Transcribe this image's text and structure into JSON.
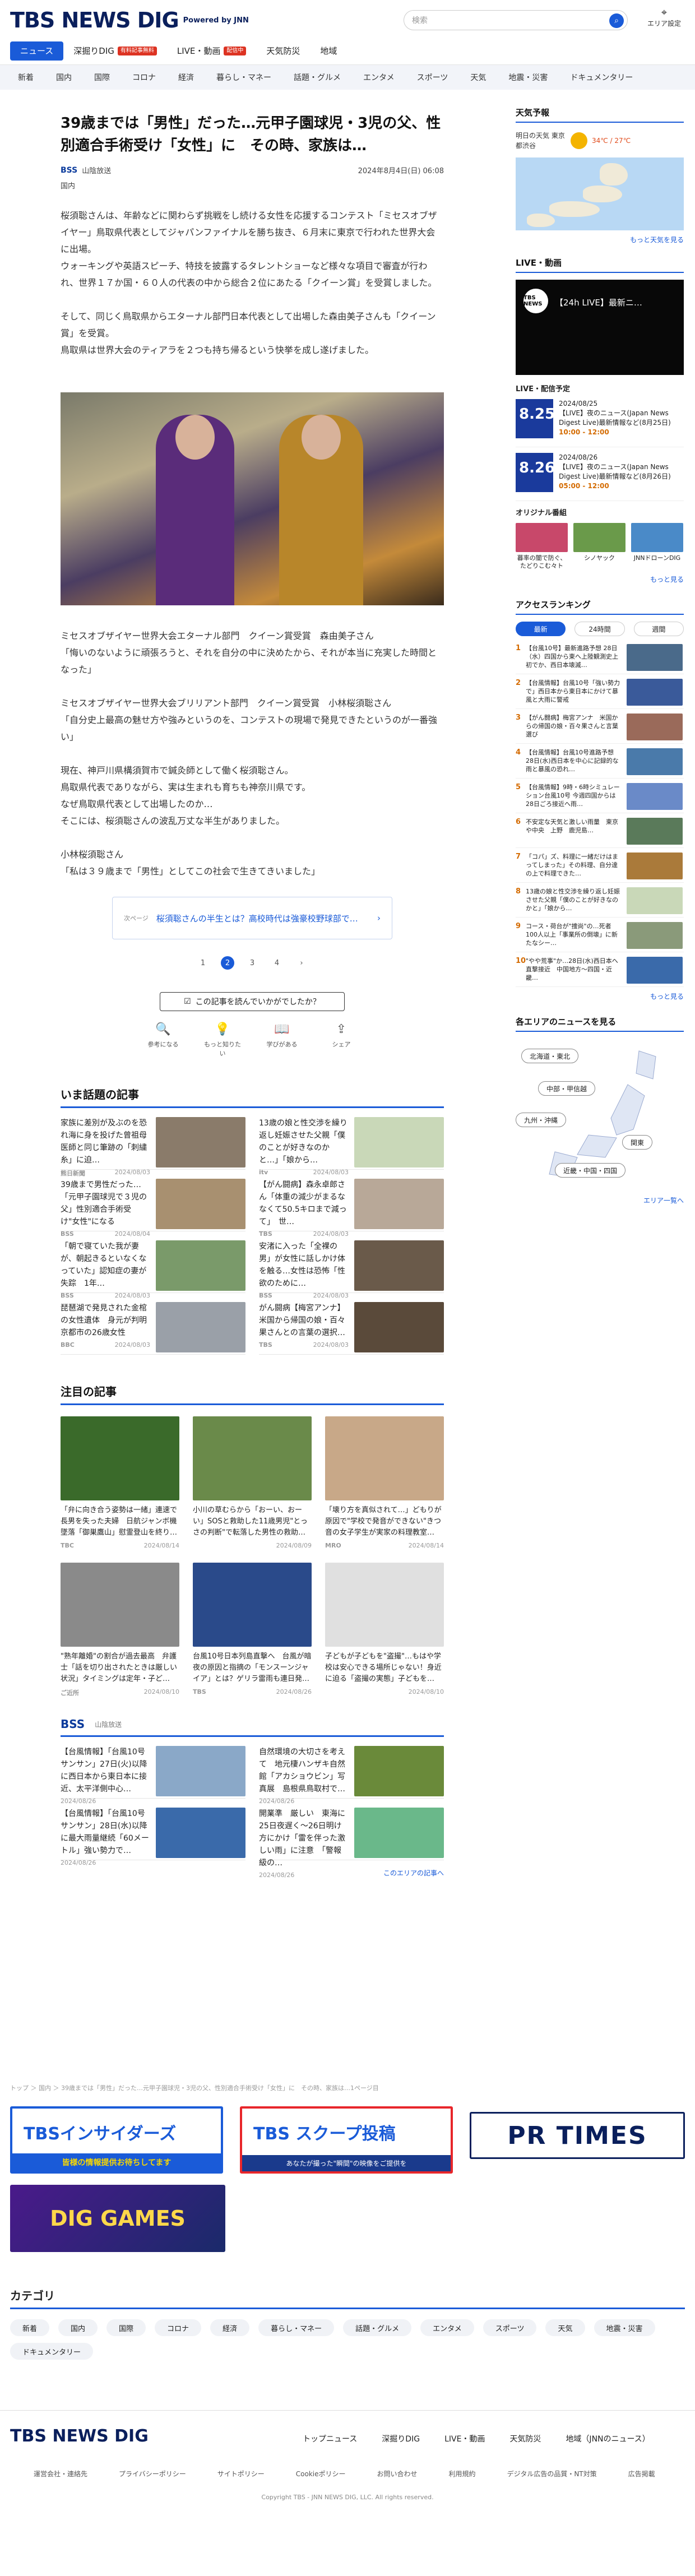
{
  "header": {
    "logo": "TBS NEWS DIG",
    "powered": "Powered by JNN",
    "search_placeholder": "検索",
    "area": "エリア設定"
  },
  "tabs": [
    {
      "label": "ニュース",
      "on": true
    },
    {
      "label": "深掘りDIG",
      "badge": "有料記事無料"
    },
    {
      "label": "LIVE・動画",
      "badge": "配信中"
    },
    {
      "label": "天気防災"
    },
    {
      "label": "地域"
    }
  ],
  "cats": [
    "新着",
    "国内",
    "国際",
    "コロナ",
    "経済",
    "暮らし・マネー",
    "話題・グルメ",
    "エンタメ",
    "スポーツ",
    "天気",
    "地震・災害",
    "ドキュメンタリー"
  ],
  "article": {
    "title": "39歳までは「男性」だった…元甲子園球児・3児の父、性別適合手術受け「女性」に　その時、家族は…",
    "source": "BSS",
    "source_name": "山陰放送",
    "date": "2024年8月4日(日) 06:08",
    "genre": "国内",
    "paras": [
      "桜須聡さんは、年齢などに関わらず挑戦をし続ける女性を応援するコンテスト「ミセスオブザイヤー」鳥取県代表としてジャパンファイナルを勝ち抜き、６月末に東京で行われた世界大会に出場。",
      "ウォーキングや英語スピーチ、特技を披露するタレントショーなど様々な項目で審査が行われ、世界１７か国・６０人の代表の中から総合２位にあたる「クイーン賞」を受賞しました。",
      "そして、同じく鳥取県からエターナル部門日本代表として出場した森由美子さんも「クイーン賞」を受賞。",
      "鳥取県は世界大会のティアラを２つも持ち帰るという快挙を成し遂げました。"
    ],
    "paras2": [
      "ミセスオブザイヤー世界大会エターナル部門　クイーン賞受賞　森由美子さん",
      "「悔いのないように頑張ろうと、それを自分の中に決めたから、それが本当に充実した時間となった」"
    ],
    "paras3": [
      "ミセスオブザイヤー世界大会ブリリアント部門　クイーン賞受賞　小林桜須聡さん",
      "「自分史上最高の魅せ方や強みというのを、コンテストの現場で発見できたというのが一番強い」"
    ],
    "paras4": [
      "現在、神戸川県構須賀市で鍼灸師として働く桜須聡さん。",
      "鳥取県代表でありながら、実は生まれも育ちも神奈川県です。",
      "なぜ鳥取県代表として出場したのか…",
      "そこには、桜須聡さんの波乱万丈な半生がありました。"
    ],
    "paras5": [
      "小林桜須聡さん",
      "「私は３９歳まで「男性」としてこの社会で生きてきいました」"
    ]
  },
  "next": {
    "tag": "次ページ",
    "text": "桜須聡さんの半生とは？高校時代は強豪校野球部で…"
  },
  "pager": [
    "1",
    "2",
    "3",
    "4"
  ],
  "feedback": {
    "q": "この記事を読んでいかがでしたか？",
    "btns": [
      {
        "i": "🔍",
        "l": "参考になる"
      },
      {
        "i": "💡",
        "l": "もっと知りたい"
      },
      {
        "i": "📖",
        "l": "学びがある"
      },
      {
        "i": "⇪",
        "l": "シェア"
      }
    ]
  },
  "hot": {
    "title": "いま話題の記事",
    "items": [
      {
        "t": "家族に差別が及ぶのを恐れ海に身を投げた曾祖母　医師と同じ筆跡の「刺繍糸」に迫…",
        "s": "熊日新聞",
        "d": "2024/08/03",
        "c": "#8a7b6a"
      },
      {
        "t": "13歳の娘と性交渉を繰り返し妊娠させた父親「僕のことが好きなのかと…」「娘から…",
        "s": "itv",
        "d": "2024/08/03",
        "c": "#c9d8b8"
      },
      {
        "t": "39歳まで男性だった…「元甲子園球児で３児の父」性別適合手術受け\"女性\"になる",
        "s": "BSS",
        "d": "2024/08/04",
        "c": "#a89070"
      },
      {
        "t": "【がん闘病】森永卓郎さん「体重の減少がまるななくて50.5キロまで減って」　世…",
        "s": "TBS",
        "d": "2024/08/03",
        "c": "#b8a898"
      },
      {
        "t": "「朝で寝ていた我が妻が、朝起きるといなくなっていた」認知症の妻が失踪　1年…",
        "s": "BSS",
        "d": "2024/08/03",
        "c": "#7a9a6a"
      },
      {
        "t": "安渚に入った「全裸の男」が女性に話しかけ体を触る…女性は恐怖「性欲のために…",
        "s": "BSS",
        "d": "2024/08/03",
        "c": "#6a5a4a"
      },
      {
        "t": "琵琶湖で発見された金棺の女性遺体　身元が判明　京都市の26歳女性",
        "s": "BBC",
        "d": "2024/08/03",
        "c": "#9aa0a8"
      },
      {
        "t": "がん闘病【梅宮アンナ】米国から帰国の娘・百々果さんとの言葉の選択…",
        "s": "TBS",
        "d": "2024/08/03",
        "c": "#5a4a3a"
      }
    ]
  },
  "feature": {
    "title": "注目の記事",
    "items": [
      {
        "t": "「弁に向き合う姿勢は一緒」連速で長男を失った夫婦　日航ジャンボ機墜落「御巣鷹山」慰霊登山を終り…",
        "s": "TBC",
        "d": "2024/08/14",
        "c": "#3a6a2a"
      },
      {
        "t": "小川の草むらから「おーい、おーい」SOSと救助した11歳男児\"とっさの判断\"で転落した男性の救助…",
        "s": "",
        "d": "2024/08/09",
        "c": "#6a8a4a"
      },
      {
        "t": "「壊り方を真似されて…」どもりが原因で\"学校で発音ができない\"きつ音の女子学生が実家の料理教室…",
        "s": "MRO",
        "d": "2024/08/14",
        "c": "#c8a888"
      },
      {
        "t": "\"熟年離婚\"の割合が過去最高　弁護士「話を切り出されたときは厳しい状況」タイミングは定年・子ど…",
        "s": "ご近所",
        "d": "2024/08/10",
        "c": "#8a8a8a"
      },
      {
        "t": "台風10号日本列島直撃へ　台風が暗夜の原因と指摘の「モンスーンジャイア」とは？ゲリラ雷雨も連日発…",
        "s": "TBS",
        "d": "2024/08/26",
        "c": "#2a4a8a"
      },
      {
        "t": "子どもが子どもを\"盗撮\"…もはや学校は安心できる場所じゃない！身近に迫る「盗撮の実態」子どもを…",
        "s": "",
        "d": "2024/08/10",
        "c": "#e0e0e0"
      }
    ]
  },
  "bss": {
    "label": "BSS",
    "sub": "山陰放送",
    "items": [
      {
        "t": "【台風情報】「台風10号 サンサン」27日(火)以降に西日本から東日本に接近、太平洋側中心…",
        "d": "2024/08/26",
        "c": "#8aa8c8"
      },
      {
        "t": "自然環境の大切さを考えて　地元棲ハンザキ自然館「アカショウビン」写真展　島根県鳥取村で…",
        "d": "2024/08/26",
        "c": "#6a8a3a"
      },
      {
        "t": "【台風情報】「台風10号 サンサン」28日(水)以降に最大雨量継続「60メートル」強い勢力で…",
        "d": "2024/08/26",
        "c": "#3a6aaa"
      },
      {
        "t": "開業準　厳しい　東海に25日夜遅く～26日明け方にかけ「雷を伴った激しい雨」に注意　「警報級の…",
        "d": "2024/08/26",
        "c": "#6ab88a"
      }
    ],
    "more": "このエリアの記事へ"
  },
  "crumb": "トップ ＞ 国内 ＞ 39歳までは「男性」だった…元甲子園球児・3児の父、性別適合手術受け「女性」に　その時、家族は…1ページ目",
  "side": {
    "weather_title": "天気予報",
    "weather_city": "明日の天気 東京都渋谷",
    "temp": "34℃ / 27℃",
    "weather_more": "もっと天気を見る",
    "live_title": "LIVE・動画",
    "live_text": "【24h LIVE】最新ニ…",
    "live_icon": "TBS NEWS",
    "sched_title": "LIVE・配信予定",
    "sched": [
      {
        "d": "8.25",
        "tag": "2024/08/25",
        "t": "【LIVE】夜のニュース(Japan News Digest Live)最新情報など(8月25日)",
        "tm": "10:00 - 12:00"
      },
      {
        "d": "8.26",
        "tag": "2024/08/26",
        "t": "【LIVE】夜のニュース(Japan News Digest Live)最新情報など(8月26日)",
        "tm": "05:00 - 12:00"
      }
    ],
    "orig_title": "オリジナル番組",
    "origs": [
      {
        "l": "暮率の闇で防ぐ、たどりこむ々ト",
        "c": "#c8486a"
      },
      {
        "l": "シノヤック",
        "c": "#6a9a4a"
      },
      {
        "l": "JNNドローンDIG",
        "c": "#4a8ac8"
      }
    ],
    "orig_more": "もっと見る",
    "rank_title": "アクセスランキング",
    "rank_tabs": [
      {
        "l": "最新",
        "on": true
      },
      {
        "l": "24時間"
      },
      {
        "l": "週間"
      }
    ],
    "ranks": [
      {
        "t": "【台風10号】最新進路予想 28日（水）四国から東へ上陸観測史上初でか、西日本壊滅…",
        "c": "#4a6a8a"
      },
      {
        "t": "【台風情報】台風10号「強い勢力で」西日本から東日本にかけて暴風と大雨に警戒",
        "c": "#3a5a9a"
      },
      {
        "t": "【がん闘病】梅宮アンナ　米国からの帰国の娘・百々果さんと言葉選び",
        "c": "#9a6a5a"
      },
      {
        "t": "【台風情報】台風10号進路予想 28日(水)西日本を中心に記録的な雨と暴風の恐れ…",
        "c": "#4a7aaa"
      },
      {
        "t": "【台風情報】9時・6時シミュレーション台風10号 今週四国からは28日ごろ接近へ雨…",
        "c": "#6a8ac8"
      },
      {
        "t": "不安定な天気と激しい雨量　東京や中央　上野　鹿児島…",
        "c": "#5a7a5a"
      },
      {
        "t": "「コパ」ズ、料理に一緒だけはまってしまった」その料理、自分達の上で料理できた…",
        "c": "#aa7a3a"
      },
      {
        "t": "13歳の娘と性交渉を繰り返し妊娠させた父親「僕のことが好きなのかと」「娘から…",
        "c": "#c9d8b8"
      },
      {
        "t": "コース・荷台が\"捜尚\"の…死者100人以上「事業所の倒壊」に新たなシー…",
        "c": "#8a9a7a"
      },
      {
        "t": "\"やや荒事\"か…28日(水)西日本へ直撃接近　中国地方～四国・近畿…",
        "c": "#3a6aaa"
      }
    ],
    "rank_more": "もっと見る",
    "area_title": "各エリアのニュースを見る",
    "area_btns": [
      "北海道・東北",
      "中部・甲信越",
      "九州・沖縄",
      "関東",
      "近畿・中国・四国"
    ],
    "area_more": "エリア一覧へ"
  },
  "categories_title": "カテゴリ",
  "categories": [
    "新着",
    "国内",
    "国際",
    "コロナ",
    "経済",
    "暮らし・マネー",
    "話題・グルメ",
    "エンタメ",
    "スポーツ",
    "天気",
    "地震・災害",
    "ドキュメンタリー"
  ],
  "footer": {
    "logo": "TBS NEWS DIG",
    "links": [
      "トップニュース",
      "深掘りDIG",
      "LIVE・動画",
      "天気防災",
      "地域（JNNのニュース）"
    ],
    "links2": [
      "運営会社・連絡先",
      "プライバシーポリシー",
      "サイトポリシー",
      "Cookieポリシー",
      "お問い合わせ",
      "利用規約",
      "デジタル広告の品質・NT対策",
      "広告掲載"
    ],
    "copy": "Copyright TBS - JNN NEWS DIG, LLC. All rights reserved."
  },
  "banners": {
    "insiders": "TBSインサイダーズ",
    "insiders_sub": "皆様の情報提供お待ちしてます",
    "scoop": "TBS スクープ投稿",
    "scoop_sub": "あなたが撮った\"瞬間\"の映像をご提供を",
    "prtimes": "PR TIMES",
    "dig_games": "DIG GAMES"
  }
}
